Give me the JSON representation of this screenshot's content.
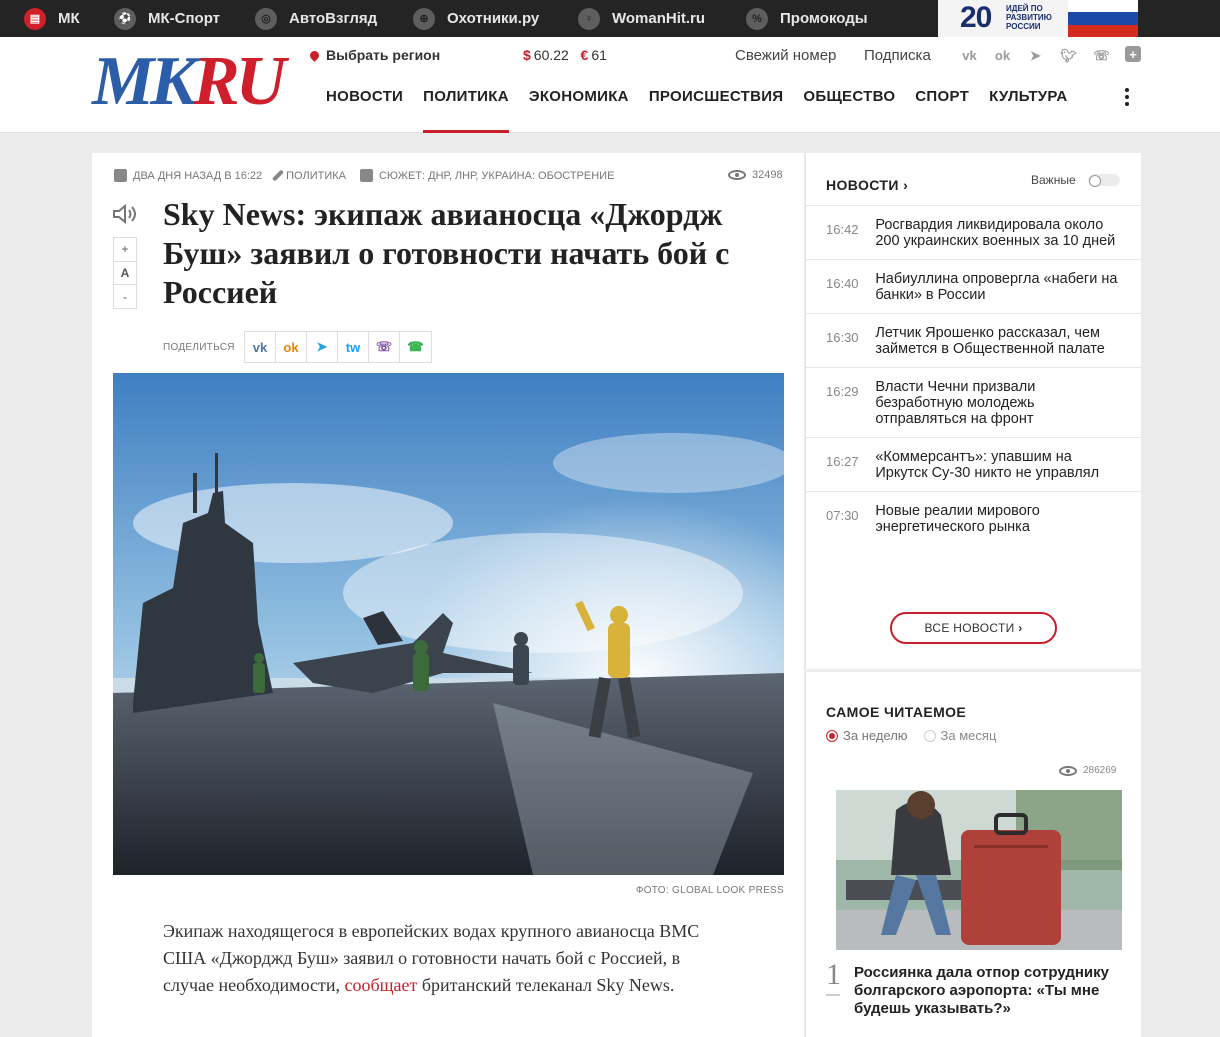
{
  "netbar": {
    "items": [
      {
        "label": "МК",
        "icon": "mk-doc-icon"
      },
      {
        "label": "МК-Спорт",
        "icon": "soccer-ball-icon"
      },
      {
        "label": "АвтоВзгляд",
        "icon": "steering-wheel-icon"
      },
      {
        "label": "Охотники.ру",
        "icon": "target-icon"
      },
      {
        "label": "WomanHit.ru",
        "icon": "female-symbol-icon"
      },
      {
        "label": "Промокоды",
        "icon": "promo-tag-icon"
      }
    ],
    "promo": {
      "number": "20",
      "text": "идей по развитию России"
    }
  },
  "header": {
    "logo_mk": "MK",
    "logo_ru": "RU",
    "region": "Выбрать регион",
    "usd_symbol": "$",
    "usd": "60.22",
    "eur_symbol": "€",
    "eur": "61",
    "fresh": "Свежий номер",
    "subscribe": "Подписка",
    "socials": [
      "vk-icon",
      "odnoklassniki-icon",
      "telegram-icon",
      "twitter-icon",
      "viber-icon",
      "plus-icon"
    ],
    "nav": [
      "НОВОСТИ",
      "ПОЛИТИКА",
      "ЭКОНОМИКА",
      "ПРОИСШЕСТВИЯ",
      "ОБЩЕСТВО",
      "СПОРТ",
      "КУЛЬТУРА"
    ],
    "active_nav": "ПОЛИТИКА"
  },
  "article": {
    "date": "два дня назад в 16:22",
    "rubric": "Политика",
    "story": "Сюжет: ДНР, ЛНР, Украина: обострение",
    "views": "32498",
    "font_plus": "+",
    "font_a": "A",
    "font_minus": "-",
    "title": "Sky News: экипаж авианосца «Джордж Буш» заявил о готовности начать бой с Россией",
    "share_label": "Поделиться",
    "share": [
      {
        "icon": "vk-icon",
        "glyph": "vk",
        "color": "#4a76a8"
      },
      {
        "icon": "odnoklassniki-icon",
        "glyph": "ok",
        "color": "#ee8208"
      },
      {
        "icon": "telegram-icon",
        "glyph": "➤",
        "color": "#2aa3dd"
      },
      {
        "icon": "twitter-icon",
        "glyph": "tw",
        "color": "#1da1f2"
      },
      {
        "icon": "viber-icon",
        "glyph": "☏",
        "color": "#7b519d"
      },
      {
        "icon": "whatsapp-icon",
        "glyph": "☎",
        "color": "#3cb44f"
      }
    ],
    "photo_credit": "Фото: Global Look Press",
    "lead_before": "Экипаж находящегося в европейских водах крупного авианосца ВМС США «Джорджд Буш» заявил о готовности начать бой с Россией, в случае необходимости, ",
    "lead_link": "сообщает",
    "lead_after": " британский телеканал Sky News."
  },
  "news": {
    "heading": "НОВОСТИ",
    "heading_arrow": "›",
    "important_label": "Важные",
    "items": [
      {
        "time": "16:42",
        "text": "Росгвардия ликвидировала около 200 украинских военных за 10 дней"
      },
      {
        "time": "16:40",
        "text": "Набиуллина опровергла «набеги на банки» в России"
      },
      {
        "time": "16:30",
        "text": "Летчик Ярошенко рассказал, чем займется в Общественной палате"
      },
      {
        "time": "16:29",
        "text": "Власти Чечни призвали безработную молодежь отправляться на фронт"
      },
      {
        "time": "16:27",
        "text": "«Коммерсантъ»: упавшим на Иркутск Су-30 никто не управлял"
      },
      {
        "time": "07:30",
        "text": "Новые реалии мирового энергетического рынка"
      }
    ],
    "all_label": "ВСЕ НОВОСТИ",
    "all_arrow": "›"
  },
  "most_read": {
    "heading": "САМОЕ ЧИТАЕМОЕ",
    "week": "За неделю",
    "month": "За месяц",
    "views": "286269",
    "rank": "1",
    "title": "Россиянка дала отпор сотруднику болгарского аэропорта: «Ты мне будешь указывать?»"
  },
  "colors": {
    "accent": "#c8202b",
    "logo_blue": "#2c5da8",
    "topbar": "#242424"
  }
}
